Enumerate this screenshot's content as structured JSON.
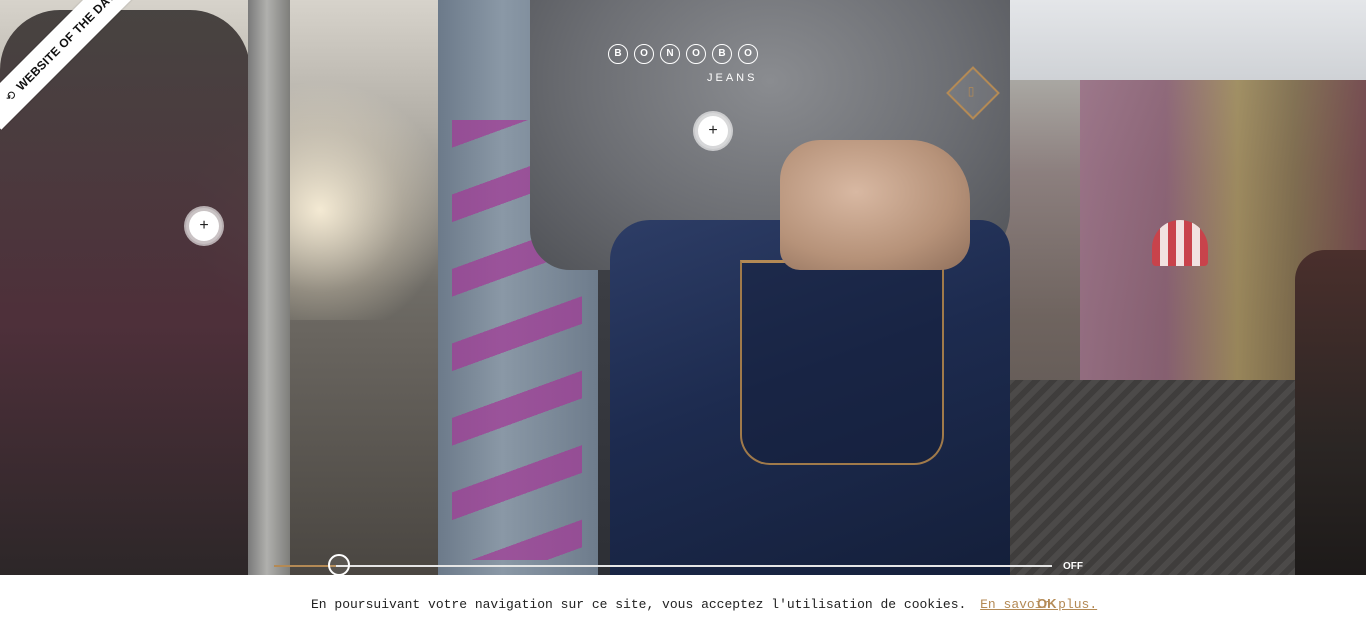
{
  "badge": {
    "label": "WEBSITE OF THE DAY",
    "icon": "awwwards-icon"
  },
  "logo": {
    "letters": [
      "B",
      "O",
      "N",
      "O",
      "B",
      "O"
    ],
    "subtitle": "JEANS"
  },
  "hotspots": [
    {
      "label": "+"
    },
    {
      "label": "+"
    }
  ],
  "lookbook": {
    "icon": "book-icon"
  },
  "slider": {
    "off_label": "OFF",
    "value_fraction": 0.08
  },
  "cookie": {
    "text": "En poursuivant votre navigation sur ce site, vous acceptez l'utilisation de cookies.",
    "link": "En savoir plus.",
    "ok": "OK"
  },
  "colors": {
    "accent": "#b48a55",
    "bar": "#ffffff"
  }
}
